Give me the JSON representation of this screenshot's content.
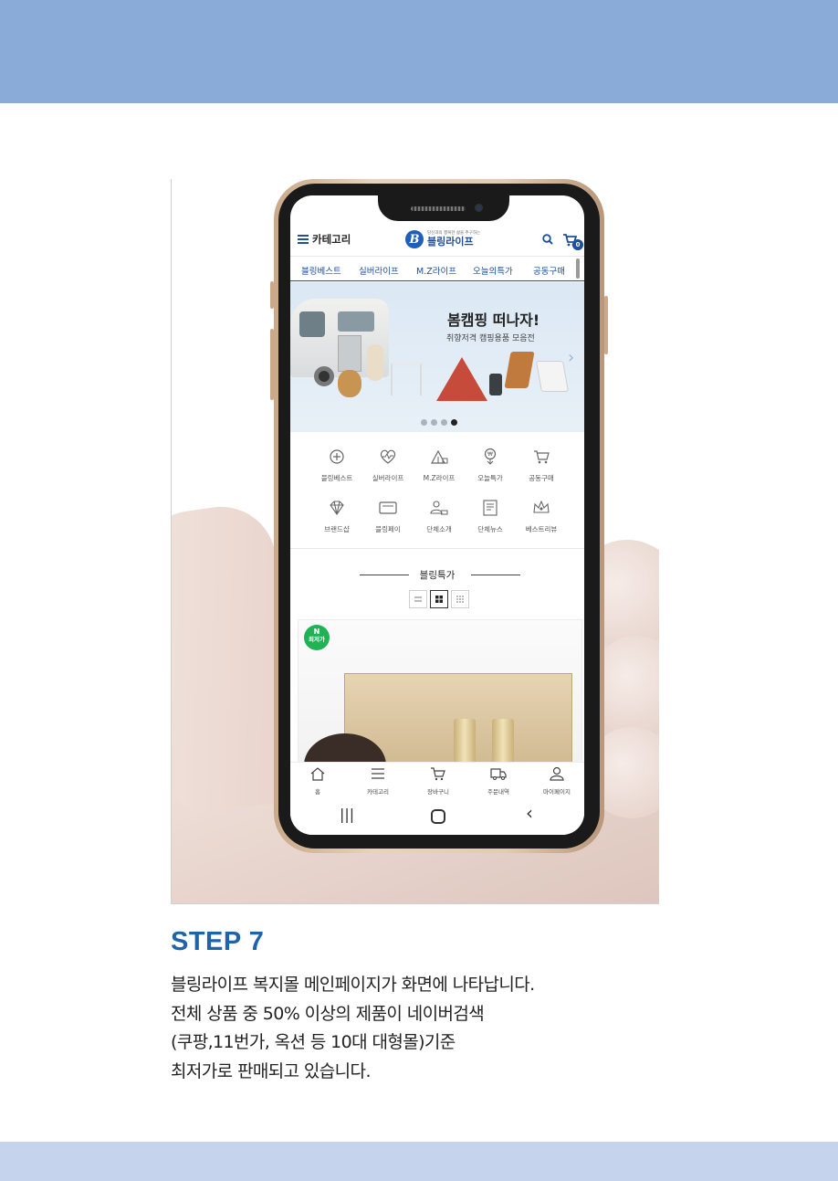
{
  "header_band": {
    "color": "#8aaad8"
  },
  "footer_band": {
    "color": "#c5d3ec"
  },
  "app": {
    "category_label": "카테고리",
    "logo": {
      "tagline": "당신과의 행복한 삶을 추구하는",
      "name": "블링라이프"
    },
    "cart_count": "0",
    "nav_tabs": [
      "블링베스트",
      "실버라이프",
      "M.Z라이프",
      "오늘의특가",
      "공동구매"
    ],
    "banner": {
      "title": "봄캠핑 떠나자!",
      "subtitle": "취향저격 캠핑용품 모음전",
      "next_icon": "chevron-right-icon",
      "dots_total": 4,
      "active_dot": 4
    },
    "categories": [
      {
        "label": "블링베스트",
        "icon": "gift-icon"
      },
      {
        "label": "실버라이프",
        "icon": "heartbeat-icon"
      },
      {
        "label": "M.Z라이프",
        "icon": "camping-icon"
      },
      {
        "label": "오늘특가",
        "icon": "coin-tag-icon"
      },
      {
        "label": "공동구매",
        "icon": "cart-icon"
      },
      {
        "label": "브랜드샵",
        "icon": "diamond-icon"
      },
      {
        "label": "블링페이",
        "icon": "card-icon"
      },
      {
        "label": "단체소개",
        "icon": "group-icon"
      },
      {
        "label": "단체뉴스",
        "icon": "news-icon"
      },
      {
        "label": "베스트리뷰",
        "icon": "crown-icon"
      }
    ],
    "deal_section": {
      "title": "블링특가",
      "views": [
        "list-view-icon",
        "grid-view-icon",
        "grid-small-view-icon"
      ],
      "active_view": "grid-view-icon",
      "badge": {
        "letter": "N",
        "label": "최저가"
      }
    },
    "bottom_nav": [
      {
        "label": "홈",
        "icon": "home-icon"
      },
      {
        "label": "카테고리",
        "icon": "menu-icon"
      },
      {
        "label": "장바구니",
        "icon": "cart-icon"
      },
      {
        "label": "주문내역",
        "icon": "truck-icon"
      },
      {
        "label": "마이페이지",
        "icon": "user-icon"
      }
    ],
    "system_nav": {
      "recent": "|||",
      "back": "‹"
    }
  },
  "step": {
    "heading": "STEP 7",
    "lines": [
      "블링라이프 복지몰 메인페이지가 화면에 나타납니다.",
      "전체 상품 중 50% 이상의 제품이 네이버검색",
      "(쿠팡,11번가, 옥션 등 10대 대형몰)기준",
      "최저가로 판매되고 있습니다."
    ],
    "heading_color": "#1f64a8"
  }
}
